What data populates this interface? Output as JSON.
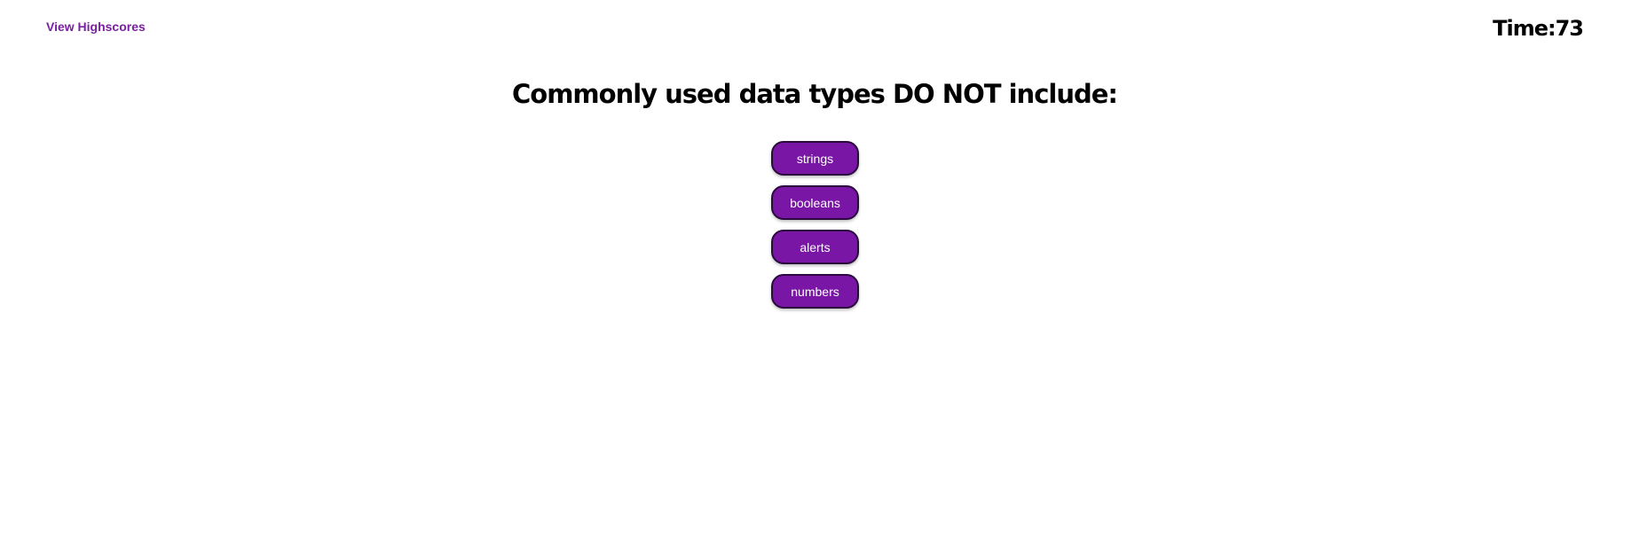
{
  "header": {
    "highscores_label": "View Highscores",
    "timer_text": "Time:73"
  },
  "quiz": {
    "question": "Commonly used data types DO NOT include:",
    "choices": [
      "strings",
      "booleans",
      "alerts",
      "numbers"
    ]
  },
  "colors": {
    "accent": "#7a16a6",
    "link": "#7a1fa2",
    "button_border": "#2b0a3d",
    "button_text": "#ffffff"
  }
}
